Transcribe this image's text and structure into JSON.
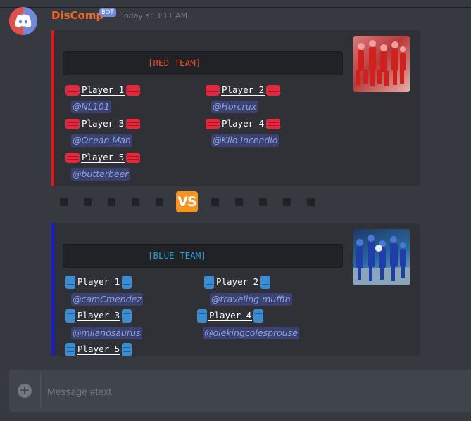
{
  "message": {
    "author": "DisComp",
    "bot_tag": "BOT",
    "timestamp": "Today at 3:11 AM"
  },
  "red_team": {
    "title": "[RED TEAM]",
    "accent_color": "#e21717",
    "player_emoji": "red-brick-icon",
    "players": [
      {
        "label": "Player 1",
        "mention": "@NL101"
      },
      {
        "label": "Player 2",
        "mention": "@Horcrux"
      },
      {
        "label": "Player 3",
        "mention": "@Ocean Man"
      },
      {
        "label": "Player 4",
        "mention": "@Kilo Incendio"
      },
      {
        "label": "Player 5",
        "mention": "@butterbeer"
      }
    ]
  },
  "versus": {
    "label": "VS",
    "color": "#f7931e"
  },
  "blue_team": {
    "title": "[BLUE TEAM]",
    "accent_color": "#1a1ad9",
    "player_emoji": "blue-battery-icon",
    "players": [
      {
        "label": "Player 1",
        "mention": "@camCmendez"
      },
      {
        "label": "Player 2",
        "mention": "@traveling muffin"
      },
      {
        "label": "Player 3",
        "mention": "@milanosaurus"
      },
      {
        "label": "Player 4",
        "mention": "@olekingcolesprouse"
      },
      {
        "label": "Player 5",
        "mention": ""
      }
    ]
  },
  "composer": {
    "placeholder": "Message #text",
    "add_icon": "plus-icon"
  }
}
